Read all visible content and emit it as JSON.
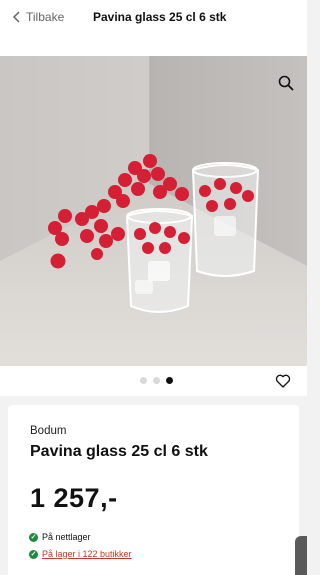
{
  "header": {
    "back_label": "Tilbake",
    "title": "Pavina glass 25 cl 6 stk"
  },
  "gallery": {
    "image_count": 3,
    "active_index": 2
  },
  "product": {
    "brand": "Bodum",
    "name": "Pavina glass 25 cl 6 stk",
    "price": "1 257,-",
    "stock_online": "På nettlager",
    "stock_stores": "På lager i 122 butikker"
  },
  "colors": {
    "stock_ok": "#1e8a3a",
    "store_link": "#c0392b"
  }
}
